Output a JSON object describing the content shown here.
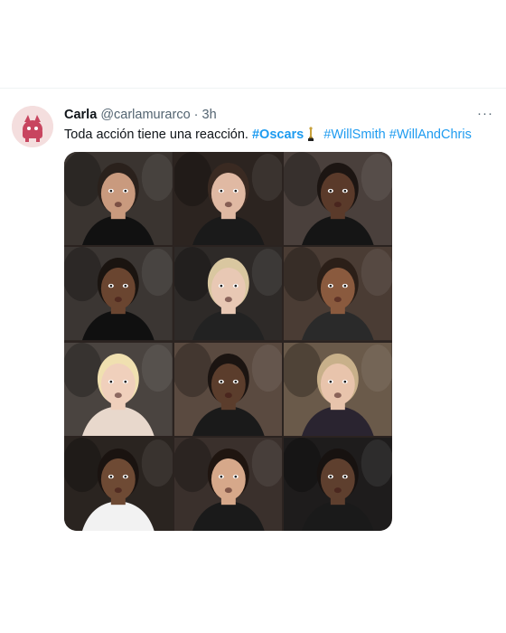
{
  "tweet": {
    "author_name": "Carla",
    "author_handle": "@carlamurarco",
    "separator": "·",
    "time": "3h",
    "more_label": "···",
    "text_plain": "Toda acción tiene una reacción.",
    "hashtags": [
      "#Oscars",
      "#WillSmith",
      "#WillAndChris"
    ]
  },
  "media": {
    "rows": 4,
    "cols": 3,
    "cells": [
      {
        "bg": "#3a3430",
        "skin": "#c99a7e",
        "hair": "#2a211c",
        "outfit": "#111111"
      },
      {
        "bg": "#2c2420",
        "skin": "#e0b9a3",
        "hair": "#3a2a22",
        "outfit": "#1a1a1a"
      },
      {
        "bg": "#4a403c",
        "skin": "#5a3a2a",
        "hair": "#1c1512",
        "outfit": "#151515"
      },
      {
        "bg": "#3b3633",
        "skin": "#6a4530",
        "hair": "#1a1410",
        "outfit": "#101010"
      },
      {
        "bg": "#2e2a28",
        "skin": "#e8c8b4",
        "hair": "#d9c7a0",
        "outfit": "#222222"
      },
      {
        "bg": "#4a3c34",
        "skin": "#8a5a3e",
        "hair": "#2b1f18",
        "outfit": "#2a2a2a"
      },
      {
        "bg": "#4a4440",
        "skin": "#f0d0bc",
        "hair": "#f0e0b0",
        "outfit": "#e8d8cc"
      },
      {
        "bg": "#5a4a40",
        "skin": "#5b3d2c",
        "hair": "#1b1411",
        "outfit": "#1a1a1a"
      },
      {
        "bg": "#6a5a4a",
        "skin": "#e8c4ac",
        "hair": "#c8b08a",
        "outfit": "#2a2430"
      },
      {
        "bg": "#2a2420",
        "skin": "#6e4a34",
        "hair": "#1a1310",
        "outfit": "#f2f2f2"
      },
      {
        "bg": "#3a302c",
        "skin": "#d6a88a",
        "hair": "#1f1510",
        "outfit": "#1a1a1a"
      },
      {
        "bg": "#1e1c1c",
        "skin": "#5e3f2e",
        "hair": "#171210",
        "outfit": "#1a1a1a"
      }
    ]
  },
  "colors": {
    "link": "#1d9bf0",
    "text": "#0f1419",
    "muted": "#536471",
    "avatar_bg": "#f4dede",
    "avatar_figure": "#c8455f"
  }
}
